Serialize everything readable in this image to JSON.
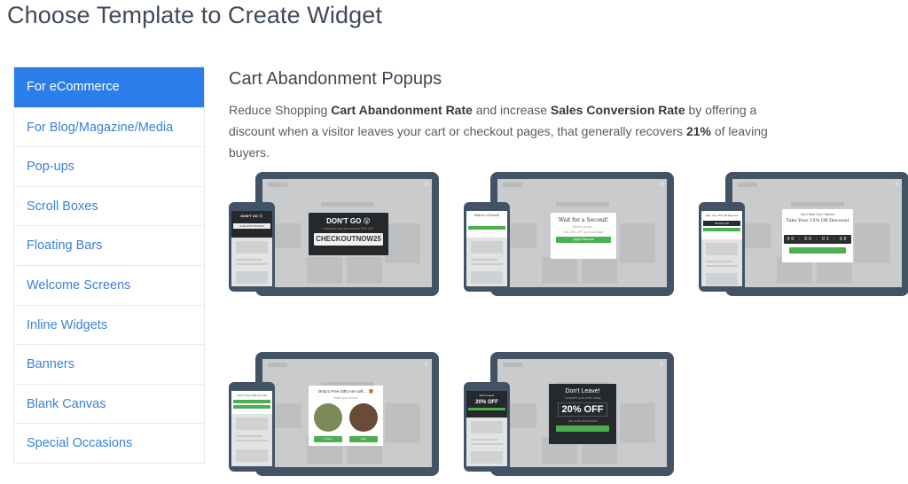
{
  "page_title": "Choose Template to Create Widget",
  "sidebar": {
    "items": [
      {
        "label": "For eCommerce",
        "active": true
      },
      {
        "label": "For Blog/Magazine/Media"
      },
      {
        "label": "Pop-ups"
      },
      {
        "label": "Scroll Boxes"
      },
      {
        "label": "Floating Bars"
      },
      {
        "label": "Welcome Screens"
      },
      {
        "label": "Inline Widgets"
      },
      {
        "label": "Banners"
      },
      {
        "label": "Blank Canvas"
      },
      {
        "label": "Special Occasions"
      }
    ]
  },
  "section": {
    "title": "Cart Abandonment Popups",
    "desc": {
      "p1": "Reduce Shopping ",
      "b1": "Cart Abandonment Rate",
      "p2": " and increase ",
      "b2": "Sales Conversion Rate",
      "p3": " by offering a discount when a visitor leaves your cart or checkout pages, that generally recovers ",
      "b3": "21%",
      "p4": " of leaving buyers."
    }
  },
  "templates": [
    {
      "title": "DON'T GO 😮",
      "code": "CHECKOUTNOW25",
      "mobile_title": "DON'T GO 😮",
      "mobile_code": "CHECKOUTNOW25"
    },
    {
      "title": "Wait for a Second!",
      "subtitle": "Before you go...",
      "button": "Apply Discount",
      "mobile_title": "Wait for a Second!"
    },
    {
      "subtitle": "Don't Miss Your Chance!",
      "title": "Take Your 15% Off Discount",
      "timer": "00 : 00 : 01 : 30",
      "mobile_title": "Take Your 15% Off Discount",
      "mobile_timer": "00 00 01 30"
    },
    {
      "title": "Only 5 Free Gifts Are Left ... 🎁",
      "subtitle": "Make your choice",
      "left_button": "T-Shirt",
      "right_button": "Mug",
      "mobile_title": "Only 5 Free Gifts Are Left"
    },
    {
      "title": "Don't Leave!",
      "offer": "20% OFF",
      "mobile_title": "Don't Leave!",
      "mobile_offer": "20% OFF"
    }
  ],
  "colors": {
    "accent": "#2b7de9",
    "link": "#3b82d9",
    "device_frame": "#435366",
    "green_button": "#4cb050"
  }
}
